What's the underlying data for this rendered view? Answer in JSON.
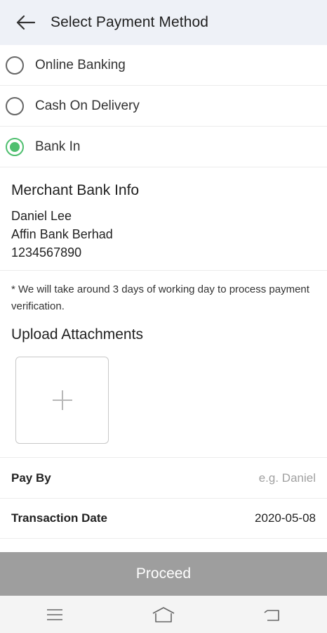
{
  "app_bar": {
    "title": "Select Payment Method",
    "back_icon": "arrow-left-icon"
  },
  "payment_options": [
    {
      "label": "Online Banking",
      "selected": false
    },
    {
      "label": "Cash On Delivery",
      "selected": false
    },
    {
      "label": "Bank In",
      "selected": true
    }
  ],
  "merchant": {
    "title": "Merchant Bank Info",
    "name": "Daniel Lee",
    "bank": "Affin Bank Berhad",
    "account": "1234567890"
  },
  "note": "* We will take around 3 days of working day to process payment verification.",
  "upload": {
    "title": "Upload Attachments",
    "icon": "plus-icon"
  },
  "form": {
    "pay_by": {
      "label": "Pay By",
      "value": "",
      "placeholder": "e.g. Daniel"
    },
    "transaction_date": {
      "label": "Transaction Date",
      "value": "2020-05-08"
    }
  },
  "proceed_label": "Proceed",
  "colors": {
    "accent": "#4fbf6f",
    "app_bar_bg": "#eef1f7",
    "proceed_bg": "#9e9e9e"
  },
  "nav_bar": {
    "icons": [
      "menu-icon",
      "home-icon",
      "back-icon"
    ]
  }
}
